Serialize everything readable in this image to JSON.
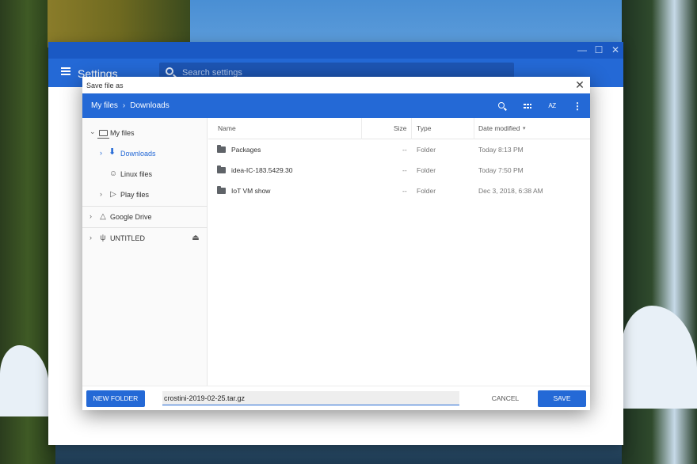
{
  "settings": {
    "title": "Settings",
    "search_placeholder": "Search settings",
    "window_controls": {
      "minimize": "—",
      "maximize": "☐",
      "close": "✕"
    }
  },
  "dialog": {
    "title": "Save file as",
    "close": "✕",
    "breadcrumb": [
      "My files",
      "Downloads"
    ],
    "breadcrumb_separator": "›",
    "toolbar": {
      "search_icon": "search-icon",
      "grid_icon": "grid-view-icon",
      "sort_label": "AZ",
      "more": "⋮"
    }
  },
  "sidebar": {
    "items": [
      {
        "label": "My files",
        "icon": "laptop-icon",
        "chevron": "⌄"
      },
      {
        "label": "Downloads",
        "icon": "download-icon",
        "chevron": "›",
        "active": true
      },
      {
        "label": "Linux files",
        "icon": "penguin-icon"
      },
      {
        "label": "Play files",
        "icon": "play-icon",
        "chevron": "›"
      },
      {
        "label": "Google Drive",
        "icon": "drive-icon",
        "chevron": "›"
      },
      {
        "label": "UNTITLED",
        "icon": "usb-icon",
        "chevron": "›",
        "eject": "⏏"
      }
    ]
  },
  "table": {
    "columns": {
      "name": "Name",
      "size": "Size",
      "type": "Type",
      "date": "Date modified",
      "sort_arrow": "▾"
    },
    "rows": [
      {
        "name": "Packages",
        "size": "--",
        "type": "Folder",
        "date": "Today 8:13 PM"
      },
      {
        "name": "idea-IC-183.5429.30",
        "size": "--",
        "type": "Folder",
        "date": "Today 7:50 PM"
      },
      {
        "name": "IoT VM show",
        "size": "--",
        "type": "Folder",
        "date": "Dec 3, 2018, 6:38 AM"
      }
    ]
  },
  "footer": {
    "new_folder": "NEW FOLDER",
    "filename": "crostini-2019-02-25.tar.gz",
    "cancel": "CANCEL",
    "save": "SAVE"
  },
  "colors": {
    "accent": "#2469d6",
    "titlebar": "#1a59c4"
  }
}
